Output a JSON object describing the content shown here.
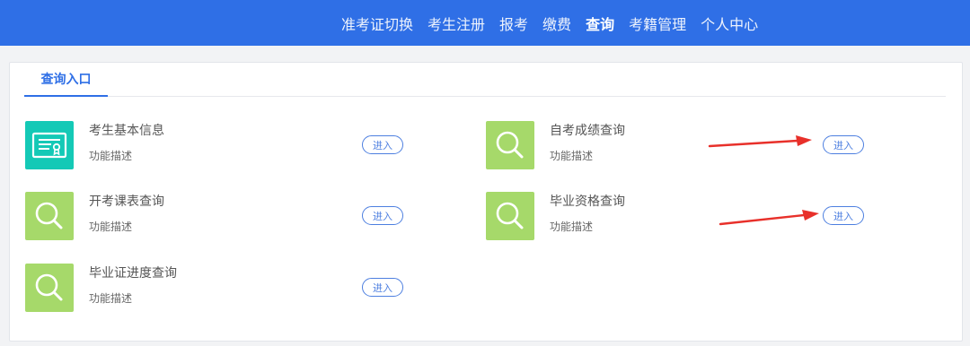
{
  "nav": {
    "items": [
      "准考证切换",
      "考生注册",
      "报考",
      "缴费",
      "查询",
      "考籍管理",
      "个人中心"
    ],
    "active": "查询"
  },
  "panel": {
    "tab_label": "查询入口"
  },
  "cards": [
    {
      "title": "考生基本信息",
      "desc": "功能描述",
      "button": "进入",
      "icon": "certificate-icon",
      "color": "#14c9b6"
    },
    {
      "title": "自考成绩查询",
      "desc": "功能描述",
      "button": "进入",
      "icon": "search-icon",
      "color": "#a6d96a"
    },
    {
      "title": "开考课表查询",
      "desc": "功能描述",
      "button": "进入",
      "icon": "search-icon",
      "color": "#a6d96a"
    },
    {
      "title": "毕业资格查询",
      "desc": "功能描述",
      "button": "进入",
      "icon": "search-icon",
      "color": "#a6d96a"
    },
    {
      "title": "毕业证进度查询",
      "desc": "功能描述",
      "button": "进入",
      "icon": "search-icon",
      "color": "#a6d96a"
    }
  ],
  "annotations": {
    "arrow_color": "#e8302a"
  }
}
